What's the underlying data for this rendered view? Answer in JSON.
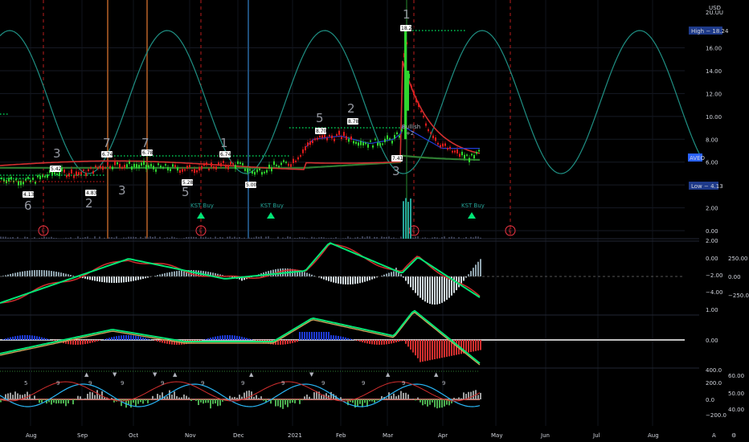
{
  "colors": {
    "background": "#000000",
    "up": "#2fd52f",
    "down": "#e01b1b",
    "cycle": "#1f8f83",
    "blue_ma": "#1e3bd6",
    "green_ma": "#2e7d32",
    "red_ma": "#d32f2f",
    "price_tag": "#1e3a8a",
    "vline_brown": "#8b4a1e",
    "vline_blue": "#1f4e79",
    "vline_red_dash": "#b71c1c",
    "kst": "#00c853"
  },
  "header": {
    "currency": "USD",
    "top_label": "2U.UU"
  },
  "price_axis": {
    "ticks": [
      "16.00",
      "14.00",
      "12.00",
      "10.00",
      "8.00",
      "6.00",
      "4.00",
      "2.00",
      "0.00"
    ],
    "high_tag": "High − 18.24",
    "low_tag": "Low − 4.13",
    "symbol_tag": "AVEO"
  },
  "time_axis": {
    "labels": [
      "Aug",
      "Sep",
      "Oct",
      "Nov",
      "Dec",
      "2021",
      "Feb",
      "Mar",
      "Apr",
      "May",
      "Jun",
      "Jul",
      "Aug"
    ],
    "corner_a": "A",
    "corner_gear": "⚙"
  },
  "chart_data": {
    "type": "line",
    "main_price": {
      "x": [
        "Jul",
        "Aug",
        "Sep",
        "Oct",
        "Nov",
        "Dec",
        "2021",
        "Feb",
        "Mar",
        "Apr"
      ],
      "values": [
        4.6,
        4.3,
        5.1,
        5.7,
        5.4,
        5.6,
        5.9,
        7.8,
        11.5,
        6.6
      ],
      "ylim": [
        0,
        19
      ]
    },
    "annotations": [
      "4.13",
      "5.42",
      "4.83",
      "6.74",
      "6.78",
      "5.28",
      "6.74",
      "5.00",
      "8.70",
      "8.78",
      "18.24",
      "7.41"
    ],
    "wave_labels": [
      "6",
      "3",
      "2",
      "7",
      "3",
      "7",
      "5",
      "1",
      "3",
      "5",
      "2",
      "1"
    ],
    "signals": [
      "KST Buy",
      "KST Buy",
      "KST Buy"
    ],
    "earnings_markers": [
      "E",
      "E",
      "E",
      "E"
    ],
    "bullish_label": "Bullish",
    "bullish_small": "+2"
  },
  "panel2_axis": {
    "left": [
      "2.00",
      "0.00",
      "−2.00",
      "−4.00"
    ],
    "right": [
      "250.00",
      "0.00",
      "−250.00"
    ]
  },
  "panel3_axis": {
    "left": [
      "1.00",
      "0.00"
    ]
  },
  "panel4_axis": {
    "left": [
      "400.0",
      "200.0",
      "0.0",
      "−200.0"
    ],
    "right": [
      "60.00",
      "50.00",
      "40.00"
    ]
  },
  "panel4_numbers": [
    "5",
    "9",
    "9",
    "9",
    "9",
    "9",
    "9",
    "9",
    "9",
    "9",
    "9",
    "9"
  ],
  "panel4_arrows": [
    "▲",
    "▼",
    "▼",
    "▲",
    "▲",
    "▼",
    "▲",
    "▲"
  ]
}
